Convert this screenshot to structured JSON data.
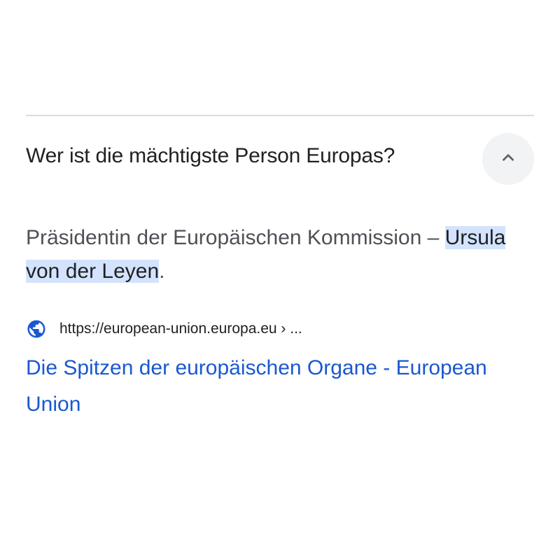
{
  "faq": {
    "question": "Wer ist die mächtigste Person Europas?",
    "toggle_icon": "chevron-up-icon"
  },
  "answer": {
    "prefix": "Präsidentin der Europäischen Kommission – ",
    "highlight": "Ursula von der Leyen",
    "suffix": "."
  },
  "source": {
    "icon": "globe-icon",
    "url": "https://european-union.europa.eu › ...",
    "title": "Die Spitzen der europäischen Organe - European Union"
  },
  "colors": {
    "link": "#1a58d0",
    "highlight_bg": "#d3e3fd",
    "toggle_bg": "#f1f3f4",
    "text_dark": "#202124",
    "text_gray": "#4d5156"
  }
}
